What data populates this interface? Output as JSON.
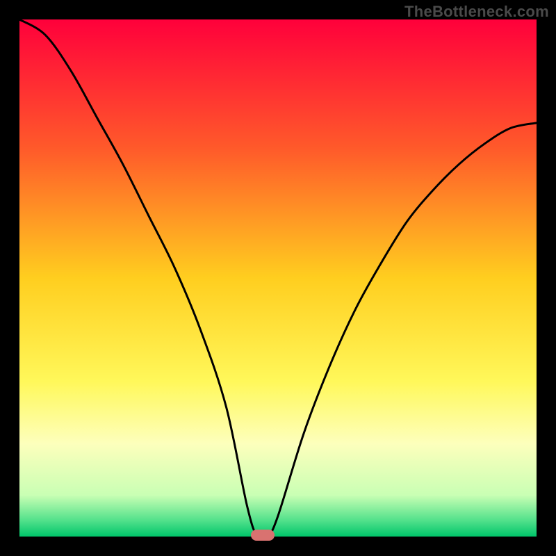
{
  "watermark": "TheBottleneck.com",
  "chart_data": {
    "type": "line",
    "title": "",
    "xlabel": "",
    "ylabel": "",
    "xlim": [
      0,
      1
    ],
    "ylim": [
      0,
      1
    ],
    "x": [
      0.0,
      0.05,
      0.1,
      0.15,
      0.2,
      0.25,
      0.3,
      0.35,
      0.4,
      0.44,
      0.46,
      0.48,
      0.5,
      0.55,
      0.6,
      0.65,
      0.7,
      0.75,
      0.8,
      0.85,
      0.9,
      0.95,
      1.0
    ],
    "values": [
      1.0,
      0.97,
      0.9,
      0.81,
      0.72,
      0.62,
      0.52,
      0.4,
      0.25,
      0.06,
      0.0,
      0.0,
      0.04,
      0.2,
      0.33,
      0.44,
      0.53,
      0.61,
      0.67,
      0.72,
      0.76,
      0.79,
      0.8
    ],
    "minimum_x": 0.47,
    "gradient_stops": [
      {
        "offset": 0.0,
        "color": "#ff003b"
      },
      {
        "offset": 0.25,
        "color": "#ff5a2a"
      },
      {
        "offset": 0.5,
        "color": "#ffce1f"
      },
      {
        "offset": 0.7,
        "color": "#fff85a"
      },
      {
        "offset": 0.82,
        "color": "#fdffbc"
      },
      {
        "offset": 0.92,
        "color": "#c9ffb4"
      },
      {
        "offset": 0.97,
        "color": "#4fe08a"
      },
      {
        "offset": 1.0,
        "color": "#00c56a"
      }
    ],
    "curve_color": "#000000",
    "curve_width": 3
  }
}
